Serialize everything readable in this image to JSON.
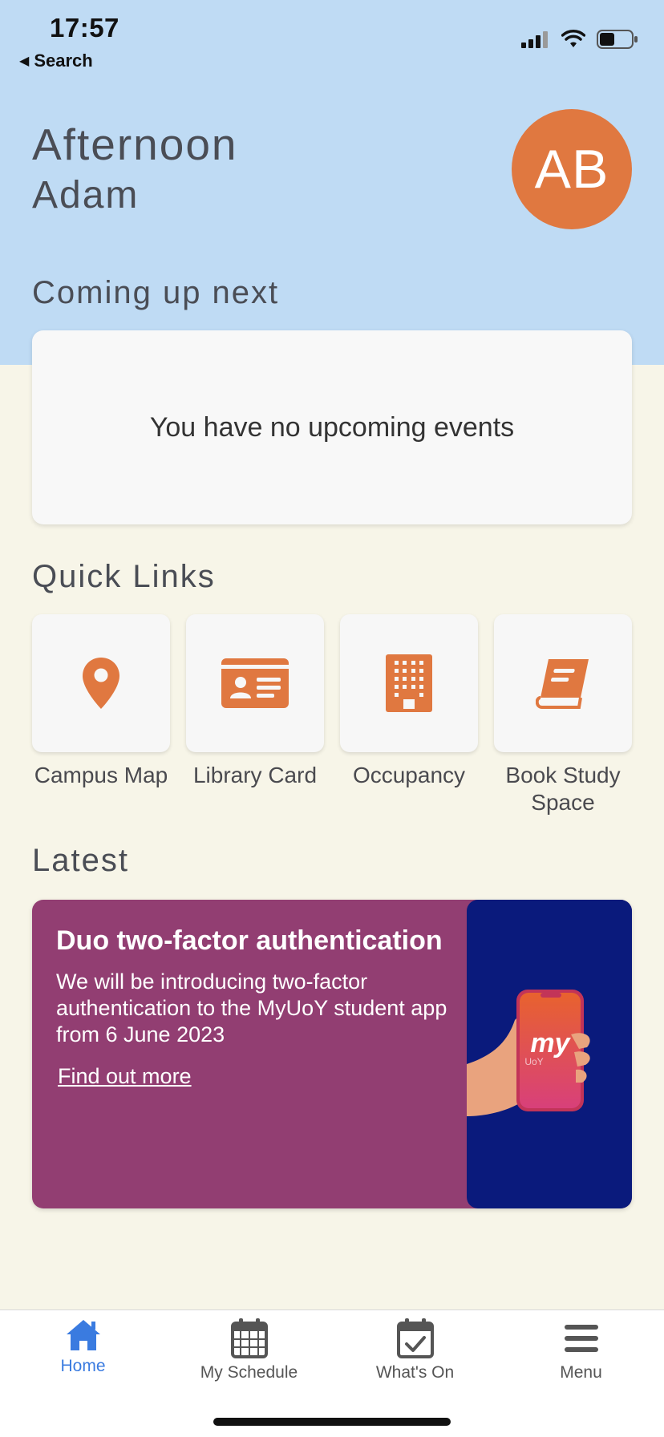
{
  "status": {
    "time": "17:57",
    "back_label": "Search"
  },
  "header": {
    "greeting": "Afternoon",
    "name": "Adam",
    "avatar_initials": "AB"
  },
  "coming_up": {
    "title": "Coming up next",
    "empty_message": "You have no upcoming events"
  },
  "quick_links": {
    "title": "Quick Links",
    "items": [
      {
        "label": "Campus Map",
        "icon": "map-pin-icon"
      },
      {
        "label": "Library Card",
        "icon": "id-card-icon"
      },
      {
        "label": "Occupancy",
        "icon": "building-icon"
      },
      {
        "label": "Book Study Space",
        "icon": "book-icon"
      }
    ]
  },
  "latest": {
    "title": "Latest",
    "card": {
      "headline": "Duo two-factor authentication",
      "body": "We will be introducing two-factor authentication to the MyUoY student app from 6 June 2023",
      "link": "Find out more",
      "image_text": "my",
      "image_subtext": "UoY"
    }
  },
  "tabbar": {
    "items": [
      {
        "label": "Home",
        "active": true
      },
      {
        "label": "My Schedule",
        "active": false
      },
      {
        "label": "What's On",
        "active": false
      },
      {
        "label": "Menu",
        "active": false
      }
    ]
  },
  "colors": {
    "accent": "#e07840",
    "header_bg": "#bfdbf4",
    "page_bg": "#f7f5e8",
    "news_bg": "#923e72",
    "news_image_bg": "#0a1a7c",
    "active_tab": "#3a7be0"
  }
}
